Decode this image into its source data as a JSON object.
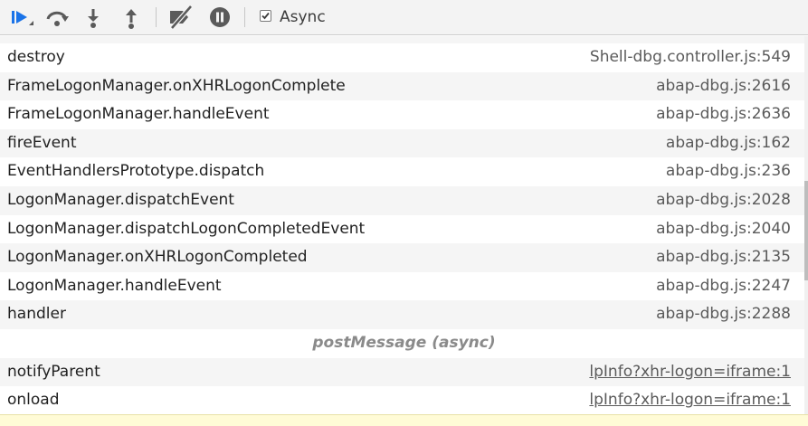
{
  "toolbar": {
    "buttons": [
      {
        "name": "resume-button",
        "icon": "resume-icon"
      },
      {
        "name": "step-over-button",
        "icon": "step-over-icon"
      },
      {
        "name": "step-into-button",
        "icon": "step-into-icon"
      },
      {
        "name": "step-out-button",
        "icon": "step-out-icon"
      },
      {
        "name": "deactivate-breakpoints-button",
        "icon": "deactivate-breakpoints-icon"
      },
      {
        "name": "pause-on-exceptions-button",
        "icon": "pause-icon"
      }
    ],
    "async_checked": true,
    "async_label": "Async"
  },
  "call_stack": {
    "partial_top": "...",
    "frames": [
      {
        "fn": "destroy",
        "loc": "Shell-dbg.controller.js:549"
      },
      {
        "fn": "FrameLogonManager.onXHRLogonComplete",
        "loc": "abap-dbg.js:2616"
      },
      {
        "fn": "FrameLogonManager.handleEvent",
        "loc": "abap-dbg.js:2636"
      },
      {
        "fn": "fireEvent",
        "loc": "abap-dbg.js:162"
      },
      {
        "fn": "EventHandlersPrototype.dispatch",
        "loc": "abap-dbg.js:236"
      },
      {
        "fn": "LogonManager.dispatchEvent",
        "loc": "abap-dbg.js:2028"
      },
      {
        "fn": "LogonManager.dispatchLogonCompletedEvent",
        "loc": "abap-dbg.js:2040"
      },
      {
        "fn": "LogonManager.onXHRLogonCompleted",
        "loc": "abap-dbg.js:2135"
      },
      {
        "fn": "LogonManager.handleEvent",
        "loc": "abap-dbg.js:2247"
      },
      {
        "fn": "handler",
        "loc": "abap-dbg.js:2288"
      }
    ],
    "async_separator": "postMessage (async)",
    "async_frames": [
      {
        "fn": "notifyParent",
        "loc": "lpInfo?xhr-logon=iframe:1"
      },
      {
        "fn": "onload",
        "loc": "lpInfo?xhr-logon=iframe:1"
      }
    ]
  },
  "colors": {
    "accent": "#1a73e8",
    "icon_gray": "#5a5a5a",
    "alt_row": "#f5f5f5",
    "status_strip": "#fffbd6"
  }
}
